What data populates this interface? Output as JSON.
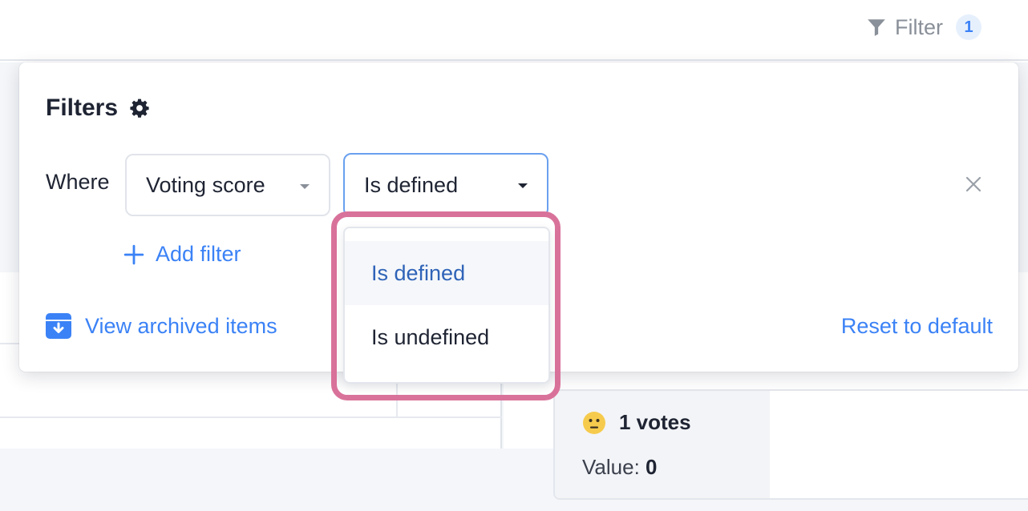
{
  "topbar": {
    "filter_label": "Filter",
    "filter_count": "1",
    "filter_icon": "funnel-icon"
  },
  "filters_panel": {
    "title": "Filters",
    "settings_icon": "gear-icon",
    "where_label": "Where",
    "field_select": {
      "value": "Voting score"
    },
    "operator_select": {
      "value": "Is defined"
    },
    "remove_icon": "close-icon",
    "add_filter_label": "Add filter",
    "archived_label": "View archived items",
    "archived_icon": "archive-box-icon",
    "reset_label": "Reset to default"
  },
  "operator_menu": {
    "options": [
      "Is defined",
      "Is undefined"
    ],
    "selected": "Is defined"
  },
  "card": {
    "emoji": "neutral-face-icon",
    "votes_label": "1 votes",
    "value_prefix": "Value:",
    "value": "0"
  },
  "colors": {
    "accent": "#3b82f6",
    "highlight": "#d9729a",
    "selected_text": "#2f63b8"
  }
}
